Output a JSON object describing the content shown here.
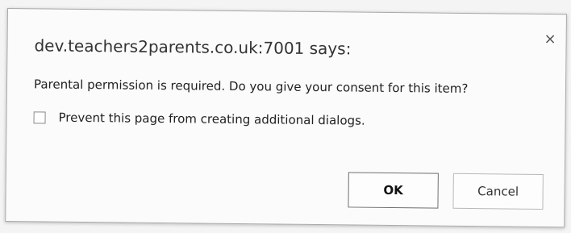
{
  "dialog": {
    "title": "dev.teachers2parents.co.uk:7001 says:",
    "close_glyph": "×",
    "message": "Parental permission is required. Do you give your consent for this item?",
    "prevent_dialogs": {
      "label": "Prevent this page from creating additional dialogs.",
      "checked": false
    },
    "buttons": {
      "ok": "OK",
      "cancel": "Cancel"
    }
  }
}
